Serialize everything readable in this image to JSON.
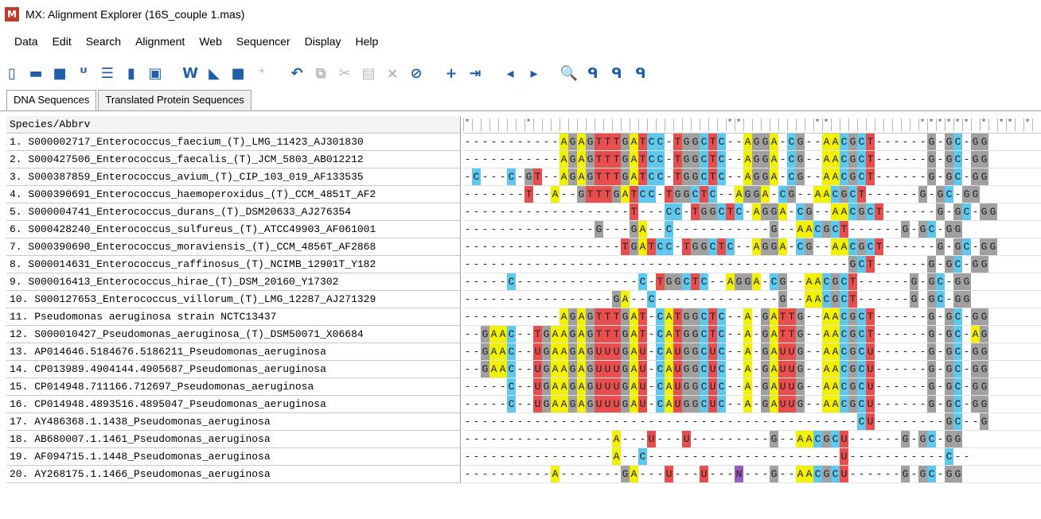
{
  "window": {
    "logo": "M",
    "title": "MX: Alignment Explorer (16S_couple 1.mas)"
  },
  "menu": [
    "Data",
    "Edit",
    "Search",
    "Alignment",
    "Web",
    "Sequencer",
    "Display",
    "Help"
  ],
  "toolbar": {
    "icons": [
      "new-file-icon",
      "open-folder-icon",
      "save-icon",
      "uuc-convert-icon",
      "sequence-list-icon",
      "align-blocks-icon",
      "at-cg-icon",
      "sep",
      "w-align-icon",
      "muscle-icon",
      "stop-icon",
      "mark-site-icon",
      "sep",
      "undo-icon",
      "copy-icon",
      "cut-icon",
      "paste-icon",
      "delete-icon",
      "delete-gap-icon",
      "sep",
      "add-sequence-icon",
      "insert-file-icon",
      "sep",
      "previous-icon",
      "next-icon",
      "sep",
      "search-icon",
      "find-previous-icon",
      "find-next-icon",
      "find-marked-icon"
    ],
    "glyphs": {
      "new-file-icon": "▯",
      "open-folder-icon": "▬",
      "save-icon": "■",
      "uuc-convert-icon": "ᵁ",
      "sequence-list-icon": "☰",
      "align-blocks-icon": "▮",
      "at-cg-icon": "▣",
      "w-align-icon": "W",
      "muscle-icon": "◣",
      "stop-icon": "■",
      "mark-site-icon": "⁺",
      "undo-icon": "↶",
      "copy-icon": "⧉",
      "cut-icon": "✂",
      "paste-icon": "▤",
      "delete-icon": "×",
      "delete-gap-icon": "⊘",
      "add-sequence-icon": "+",
      "insert-file-icon": "⇥",
      "previous-icon": "◂",
      "next-icon": "▸",
      "search-icon": "🔍",
      "find-previous-icon": "ᑫ",
      "find-next-icon": "ᑫ",
      "find-marked-icon": "ᑫ"
    },
    "disabled": [
      "copy-icon",
      "cut-icon",
      "paste-icon",
      "delete-icon",
      "mark-site-icon"
    ]
  },
  "tabs": [
    {
      "label": "DNA Sequences",
      "active": true
    },
    {
      "label": "Translated Protein Sequences",
      "active": false
    }
  ],
  "table_header": "Species/Abbrv",
  "conserved_marks": [
    0,
    7,
    30,
    31,
    40,
    41,
    52,
    53,
    54,
    55,
    56,
    57,
    59,
    61,
    62,
    64
  ],
  "base_colors": {
    "A": "#f2f200",
    "G": "#a0a0a0",
    "T": "#e84e4e",
    "U": "#e84e4e",
    "C": "#5fc8ef",
    "N": "#9a5bc0"
  },
  "sequences": [
    {
      "name": "1. S000002717_Enterococcus_faecium_(T)_LMG_11423_AJ301830",
      "seq": "-----------AGAGTTTGATCC-TGGCTC--AGGA-CG--AACGCT------G-GC-GG"
    },
    {
      "name": "2. S000427506_Enterococcus_faecalis_(T)_JCM_5803_AB012212",
      "seq": "-----------AGAGTTTGATCC-TGGCTC--AGGA-CG--AACGCT------G-GC-GG"
    },
    {
      "name": "3. S000387859_Enterococcus_avium_(T)_CIP_103_019_AF133535",
      "seq": "-C---C-GT--AGAGTTTGATCC-TGGCTC--AGGA-CG--AACGCT------G-GC-GG"
    },
    {
      "name": "4. S000390691_Enterococcus_haemoperoxidus_(T)_CCM_4851T_AF2",
      "seq": "-------T--A--GTTTGATCC-TGGCTC--AGGA-CG--AACGCT------G-GC-GG"
    },
    {
      "name": "5. S000004741_Enterococcus_durans_(T)_DSM20633_AJ276354",
      "seq": "-------------------T---CC-TGGCTC-AGGA-CG--AACGCT------G-GC-GG"
    },
    {
      "name": "6. S000428240_Enterococcus_sulfureus_(T)_ATCC49903_AF061001",
      "seq": "---------------G---GA--C-----------G--AACGCT------G-GC-GG"
    },
    {
      "name": "7. S000390690_Enterococcus_moraviensis_(T)_CCM_4856T_AF2868",
      "seq": "------------------TGATCC-TGGCTC--AGGA-CG--AACGCT------G-GC-GG"
    },
    {
      "name": "8. S000014631_Enterococcus_raffinosus_(T)_NCIMB_12901T_Y182",
      "seq": "--------------------------------------------GCT------G-GC-GG"
    },
    {
      "name": "9. S000016413_Enterococcus_hirae_(T)_DSM_20160_Y17302",
      "seq": "-----C--------------C-TGGCTC--AGGA-CG--AACGCT------G-GC-GG"
    },
    {
      "name": "10. S000127653_Enterococcus_villorum_(T)_LMG_12287_AJ271329",
      "seq": "-----------------GA--C--------------G--AACGCT------G-GC-GG"
    },
    {
      "name": "11. Pseudomonas aeruginosa strain NCTC13437",
      "seq": "-----------AGAGTTTGAT-CATGGCTC--A-GATTG--AACGCT------G-GC-GG"
    },
    {
      "name": "12. S000010427_Pseudomonas_aeruginosa_(T)_DSM50071_X06684",
      "seq": "--GAAC--TGAAGAGTTTGAT-CATGGCTC--A-GATTG--AACGCT------G-GC-AG"
    },
    {
      "name": "13. AP014646.5184676.5186211_Pseudomonas_aeruginosa",
      "seq": "--GAAC--UGAAGAGUUUGAU-CAUGGCUC--A-GAUUG--AACGCU------G-GC-GG"
    },
    {
      "name": "14. CP013989.4904144.4905687_Pseudomonas_aeruginosa",
      "seq": "--GAAC--UGAAGAGUUUGAU-CAUGGCUC--A-GAUUG--AACGCU------G-GC-GG"
    },
    {
      "name": "15. CP014948.711166.712697_Pseudomonas_aeruginosa",
      "seq": "-----C--UGAAGAGUUUGAU-CAUGGCUC--A-GAUUG--AACGCU------G-GC-GG"
    },
    {
      "name": "16. CP014948.4893516.4895047_Pseudomonas_aeruginosa",
      "seq": "-----C--UGAAGAGUUUGAU-CAUGGCUC--A-GAUUG--AACGCU------G-GC-GG"
    },
    {
      "name": "17. AY486368.1.1438_Pseudomonas_aeruginosa",
      "seq": "---------------------------------------------CU--------GC--G"
    },
    {
      "name": "18. AB680007.1.1461_Pseudomonas_aeruginosa",
      "seq": "-----------------A---U---U---------G--AACGCU------G-GC-GG"
    },
    {
      "name": "19. AF094715.1.1448_Pseudomonas_aeruginosa",
      "seq": "-----------------A--C----------------------U-----------C--"
    },
    {
      "name": "20. AY268175.1.1466_Pseudomonas_aeruginosa",
      "seq": "----------A-------GA---U---U---N---G--AACGCU------G-GC-GG"
    }
  ]
}
